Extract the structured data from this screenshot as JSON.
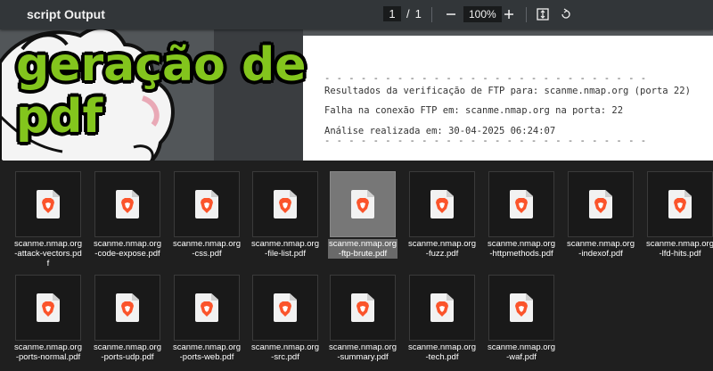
{
  "viewer": {
    "title": "script Output",
    "page_current": "1",
    "page_sep": "/",
    "page_total": "1",
    "zoom": "100%",
    "toolbar_icons": [
      "minus-icon",
      "plus-icon",
      "fit-page-icon",
      "rotate-icon"
    ]
  },
  "overlay": {
    "line1": "geração de",
    "line2": "pdf",
    "color": "#83c51d"
  },
  "document": {
    "dashes": "- - - - - - - - - - - - - - - - - - - - - - - - - - -",
    "line_result": "Resultados da verificação de FTP para: scanme.nmap.org (porta 22)",
    "line_error": "Falha na conexão FTP em: scanme.nmap.org na porta: 22",
    "line_date": "Análise realizada em: 30-04-2025 06:24:07"
  },
  "files": [
    "scanme.nmap.org-attack-vectors.pdf",
    "scanme.nmap.org-code-expose.pdf",
    "scanme.nmap.org-css.pdf",
    "scanme.nmap.org-file-list.pdf",
    "scanme.nmap.org-ftp-brute.pdf",
    "scanme.nmap.org-fuzz.pdf",
    "scanme.nmap.org-httpmethods.pdf",
    "scanme.nmap.org-indexof.pdf",
    "scanme.nmap.org-lfd-hits.pdf",
    "scanme.nmap.org-ports-normal.pdf",
    "scanme.nmap.org-ports-udp.pdf",
    "scanme.nmap.org-ports-web.pdf",
    "scanme.nmap.org-src.pdf",
    "scanme.nmap.org-summary.pdf",
    "scanme.nmap.org-tech.pdf",
    "scanme.nmap.org-waf.pdf"
  ],
  "selected_file": "scanme.nmap.org-ftp-brute.pdf",
  "colors": {
    "brave_orange": "#fb542b",
    "toolbar": "#323639"
  }
}
